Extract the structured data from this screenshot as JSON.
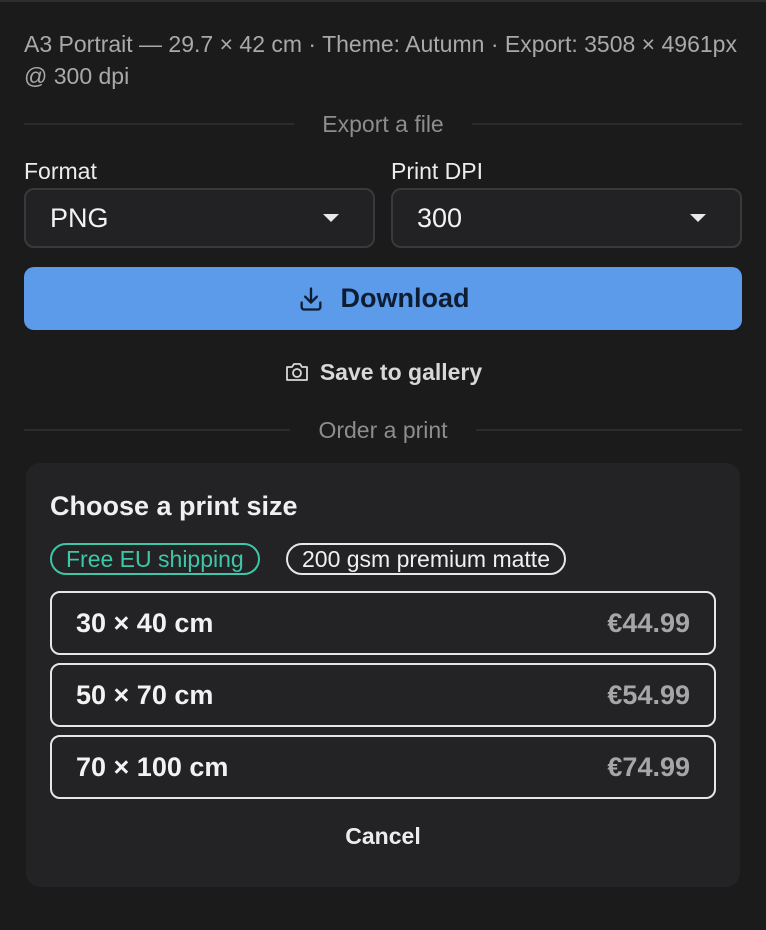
{
  "header": {
    "meta_text": "A3 Portrait — 29.7 × 42 cm · Theme: Autumn · Export: 3508 × 4961px @ 300 dpi"
  },
  "export": {
    "section_label": "Export a file",
    "format_label": "Format",
    "format_value": "PNG",
    "dpi_label": "Print DPI",
    "dpi_value": "300",
    "download_label": "Download",
    "save_gallery_label": "Save to gallery"
  },
  "order": {
    "section_label": "Order a print",
    "card_title": "Choose a print size",
    "badges": [
      "Free EU shipping",
      "200 gsm premium matte"
    ],
    "sizes": [
      {
        "size": "30 × 40 cm",
        "price": "€44.99"
      },
      {
        "size": "50 × 70 cm",
        "price": "€54.99"
      },
      {
        "size": "70 × 100 cm",
        "price": "€74.99"
      }
    ],
    "cancel_label": "Cancel"
  },
  "colors": {
    "background": "#1b1b1c",
    "accent": "#5b9bea",
    "shipping_badge": "#3dc7a8"
  },
  "icons": {
    "download": "download-icon",
    "gallery": "camera-icon",
    "dropdown": "chevron-down-icon"
  }
}
